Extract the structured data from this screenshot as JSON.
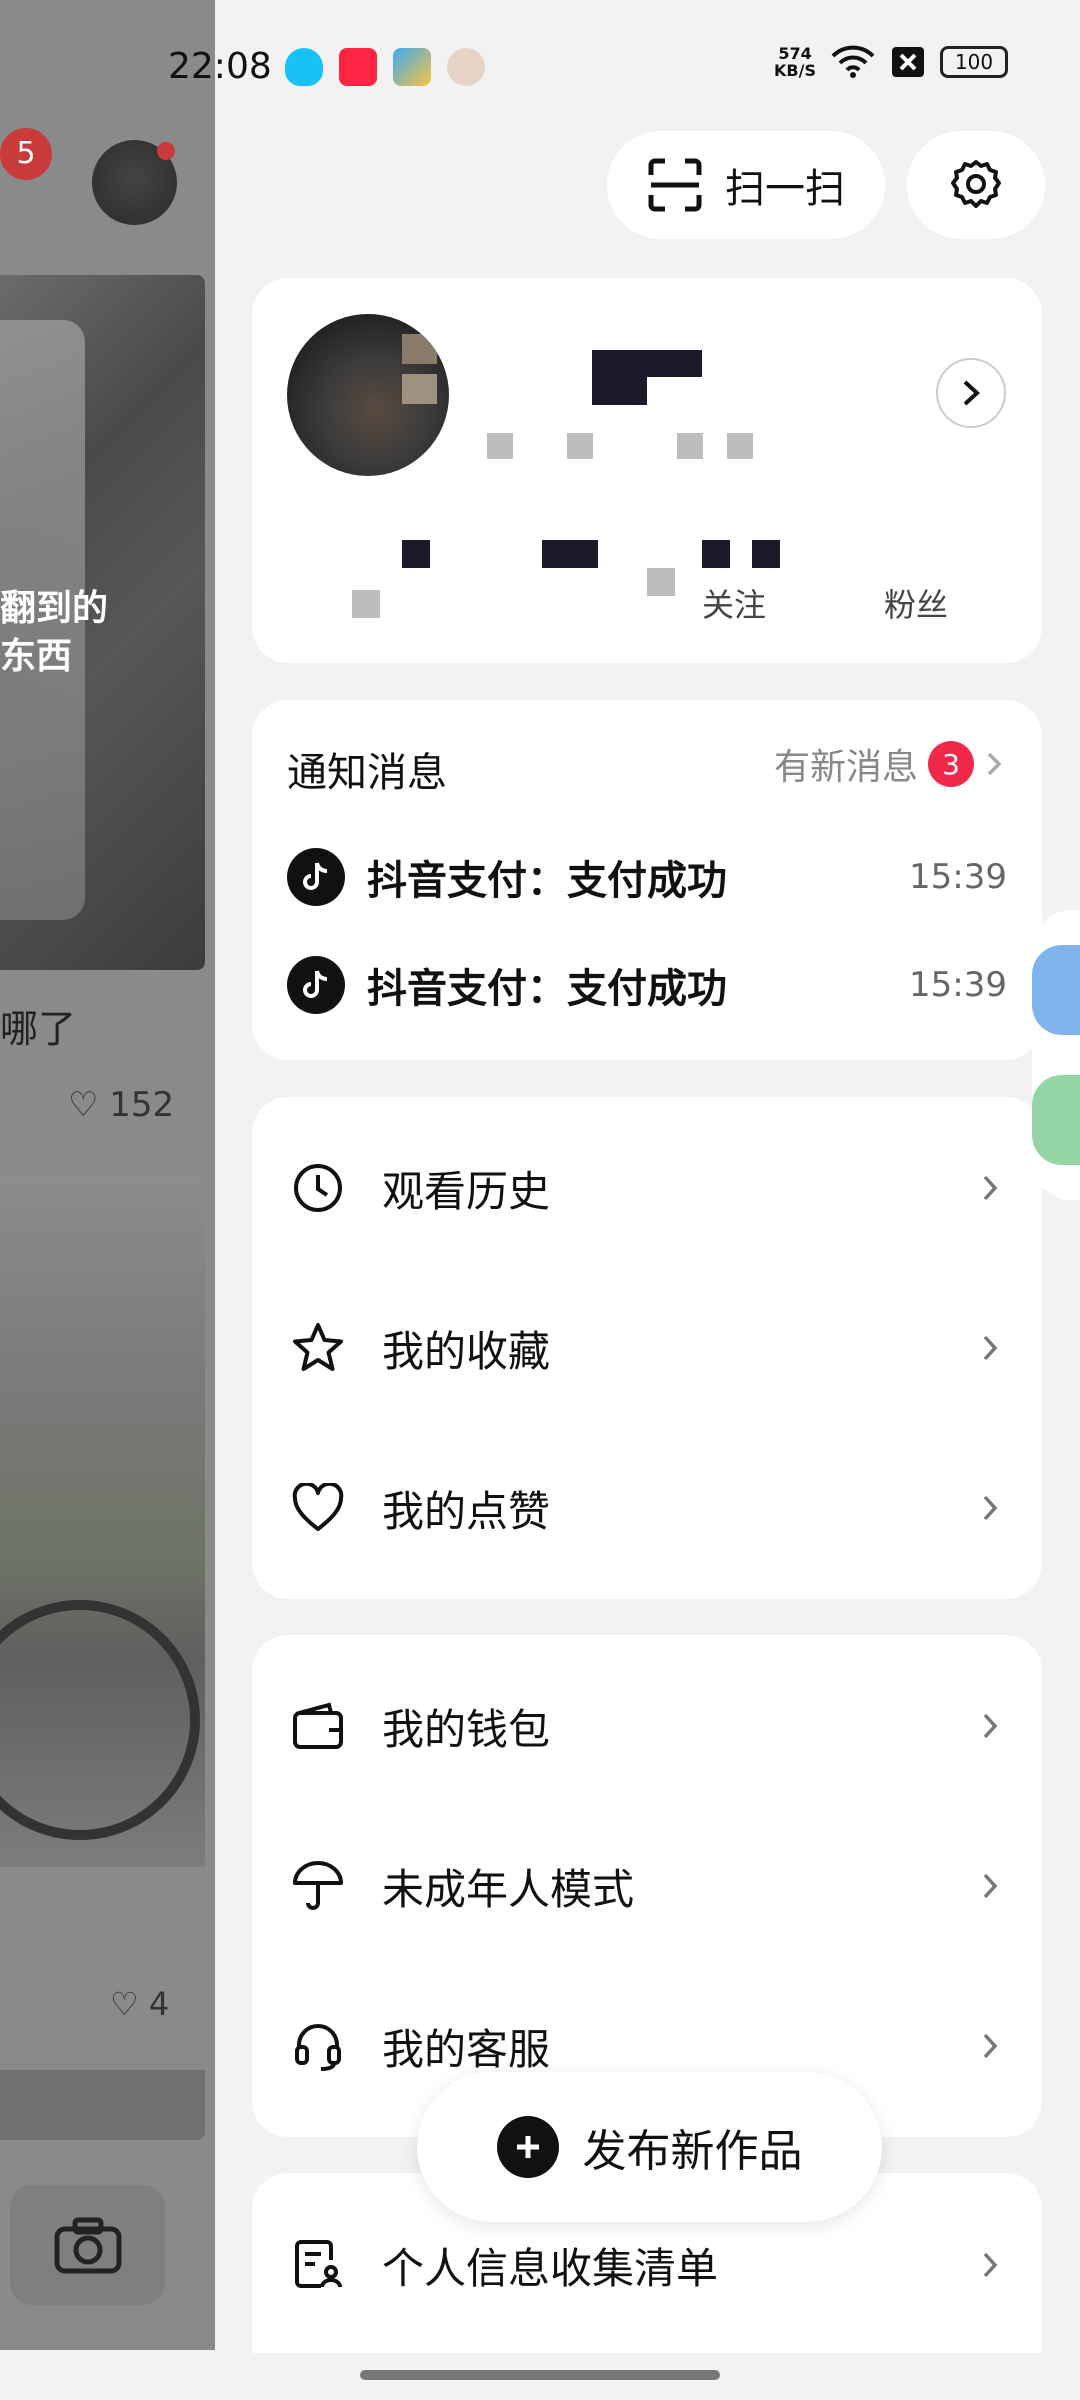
{
  "status_bar": {
    "time": "22:08",
    "net_speed_value": "574",
    "net_speed_unit": "KB/S",
    "battery": "100",
    "app_icons": [
      "qq-icon",
      "xiaohongshu-icon",
      "weather-icon",
      "avatar-app-icon"
    ]
  },
  "background_feed": {
    "badge_count": "5",
    "media_text_line1": "翻到的",
    "media_text_line2": "东西",
    "caption": "哪了",
    "likes_1": "152",
    "likes_2": "4"
  },
  "header": {
    "scan_label": "扫一扫"
  },
  "profile": {
    "stat_following_label": "关注",
    "stat_fans_label": "粉丝"
  },
  "notifications": {
    "title": "通知消息",
    "new_label": "有新消息",
    "badge_count": "3",
    "items": [
      {
        "text": "抖音支付：支付成功",
        "time": "15:39"
      },
      {
        "text": "抖音支付：支付成功",
        "time": "15:39"
      }
    ]
  },
  "menu_group_1": [
    {
      "label": "观看历史",
      "icon": "clock-icon"
    },
    {
      "label": "我的收藏",
      "icon": "star-icon"
    },
    {
      "label": "我的点赞",
      "icon": "heart-icon"
    }
  ],
  "menu_group_2": [
    {
      "label": "我的钱包",
      "icon": "wallet-icon"
    },
    {
      "label": "未成年人模式",
      "icon": "umbrella-icon"
    },
    {
      "label": "我的客服",
      "icon": "headset-icon"
    }
  ],
  "menu_group_3": [
    {
      "label": "个人信息收集清单",
      "icon": "document-user-icon"
    }
  ],
  "publish": {
    "label": "发布新作品"
  },
  "colors": {
    "badge_red": "#f0284a",
    "page_bg": "#f2f2f2",
    "card_bg": "#ffffff"
  }
}
